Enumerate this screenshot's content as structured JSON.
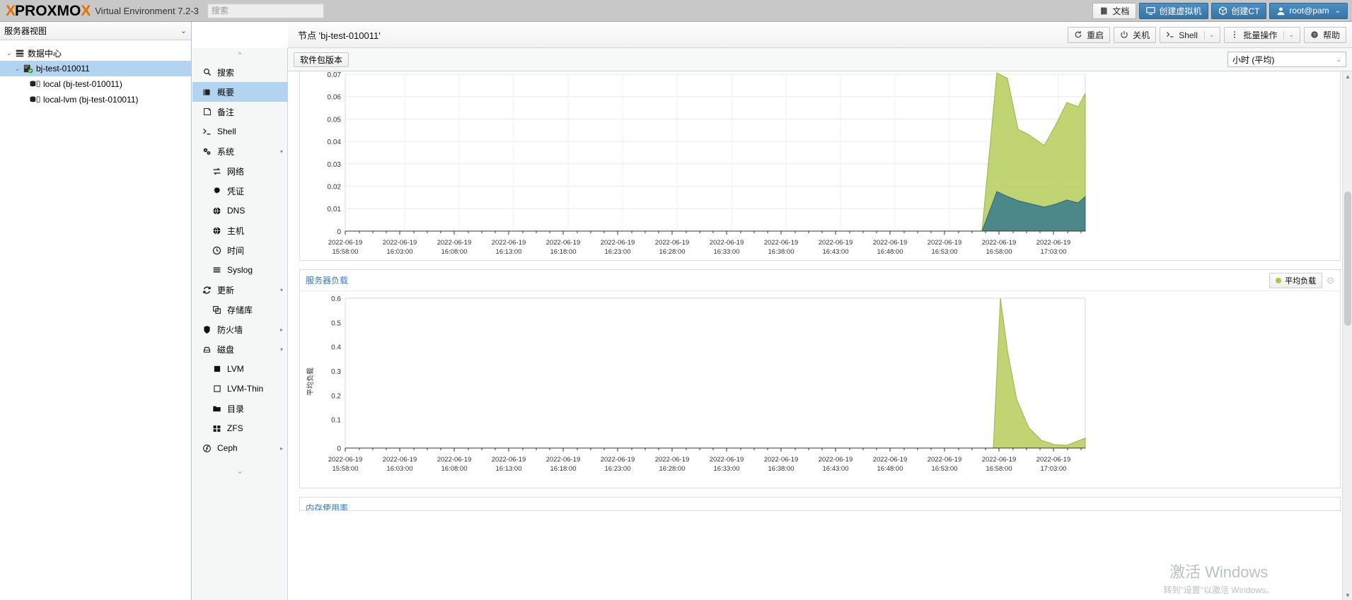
{
  "topbar": {
    "logo_x": "X",
    "logo_p": "PROXMO",
    "logo_x2": "X",
    "product": "Virtual Environment 7.2-3",
    "search_placeholder": "搜索",
    "search_value": "",
    "buttons": [
      {
        "label": "文档",
        "icon": "book-icon",
        "style": "plain"
      },
      {
        "label": "创建虚拟机",
        "icon": "monitor-icon",
        "style": "blue"
      },
      {
        "label": "创建CT",
        "icon": "container-icon",
        "style": "blue"
      },
      {
        "label": "root@pam",
        "icon": "user-icon",
        "style": "user",
        "chevron": "⌄"
      }
    ]
  },
  "sidebar": {
    "header": "服务器视图",
    "header_chevron": "⌄",
    "tree": [
      {
        "label": "数据中心",
        "icon": "datacenter-icon",
        "level": 0,
        "twisty": "⌄",
        "selected": false
      },
      {
        "label": "bj-test-010011",
        "icon": "node-icon",
        "level": 1,
        "twisty": "⌄",
        "selected": true
      },
      {
        "label": "local (bj-test-010011)",
        "icon": "storage-icon",
        "level": 2,
        "twisty": "",
        "selected": false
      },
      {
        "label": "local-lvm (bj-test-010011)",
        "icon": "storage-icon",
        "level": 2,
        "twisty": "",
        "selected": false
      }
    ]
  },
  "nodemenu": {
    "scroll_up": "⌃",
    "scroll_down": "⌄",
    "items": [
      {
        "label": "搜索",
        "icon": "search-icon",
        "sub": false,
        "selected": false,
        "arrow": ""
      },
      {
        "label": "概要",
        "icon": "summary-icon",
        "sub": false,
        "selected": true,
        "arrow": ""
      },
      {
        "label": "备注",
        "icon": "notes-icon",
        "sub": false,
        "selected": false,
        "arrow": ""
      },
      {
        "label": "Shell",
        "icon": "shell-icon",
        "sub": false,
        "selected": false,
        "arrow": ""
      },
      {
        "label": "系统",
        "icon": "system-icon",
        "sub": false,
        "selected": false,
        "arrow": "▾"
      },
      {
        "label": "网络",
        "icon": "network-icon",
        "sub": true,
        "selected": false,
        "arrow": ""
      },
      {
        "label": "凭证",
        "icon": "certificate-icon",
        "sub": true,
        "selected": false,
        "arrow": ""
      },
      {
        "label": "DNS",
        "icon": "dns-icon",
        "sub": true,
        "selected": false,
        "arrow": ""
      },
      {
        "label": "主机",
        "icon": "hosts-icon",
        "sub": true,
        "selected": false,
        "arrow": ""
      },
      {
        "label": "时间",
        "icon": "clock-icon",
        "sub": true,
        "selected": false,
        "arrow": ""
      },
      {
        "label": "Syslog",
        "icon": "syslog-icon",
        "sub": true,
        "selected": false,
        "arrow": ""
      },
      {
        "label": "更新",
        "icon": "update-icon",
        "sub": false,
        "selected": false,
        "arrow": "▾"
      },
      {
        "label": "存储库",
        "icon": "repository-icon",
        "sub": true,
        "selected": false,
        "arrow": ""
      },
      {
        "label": "防火墙",
        "icon": "firewall-icon",
        "sub": false,
        "selected": false,
        "arrow": "▸"
      },
      {
        "label": "磁盘",
        "icon": "disk-icon",
        "sub": false,
        "selected": false,
        "arrow": "▾"
      },
      {
        "label": "LVM",
        "icon": "lvm-icon",
        "sub": true,
        "selected": false,
        "arrow": ""
      },
      {
        "label": "LVM-Thin",
        "icon": "lvmthin-icon",
        "sub": true,
        "selected": false,
        "arrow": ""
      },
      {
        "label": "目录",
        "icon": "directory-icon",
        "sub": true,
        "selected": false,
        "arrow": ""
      },
      {
        "label": "ZFS",
        "icon": "zfs-icon",
        "sub": true,
        "selected": false,
        "arrow": ""
      },
      {
        "label": "Ceph",
        "icon": "ceph-icon",
        "sub": false,
        "selected": false,
        "arrow": "▸"
      }
    ]
  },
  "content": {
    "node_title": "节点 'bj-test-010011'",
    "header_buttons": [
      {
        "label": "重启",
        "icon": "restart-icon",
        "split": ""
      },
      {
        "label": "关机",
        "icon": "power-icon",
        "split": ""
      },
      {
        "label": "Shell",
        "icon": "shell-icon",
        "split": "⌄"
      },
      {
        "label": "批量操作",
        "icon": "bulk-icon",
        "split": "⌄"
      },
      {
        "label": "帮助",
        "icon": "help-icon",
        "split": ""
      }
    ],
    "tab_label": "软件包版本",
    "range_value": "小时 (平均)",
    "range_chevron": "⌄"
  },
  "chart_data": [
    {
      "type": "area",
      "title": "",
      "id": "chart-top",
      "ylabel": "",
      "xlabel": "",
      "yticks": [
        "0.07",
        "0.06",
        "0.05",
        "0.04",
        "0.03",
        "0.02",
        "0.01",
        "0"
      ],
      "ylim": [
        0,
        0.072
      ],
      "grid": true,
      "xticks": [
        "2022-06-19 15:58:00",
        "2022-06-19 16:03:00",
        "2022-06-19 16:08:00",
        "2022-06-19 16:13:00",
        "2022-06-19 16:18:00",
        "2022-06-19 16:23:00",
        "2022-06-19 16:28:00",
        "2022-06-19 16:33:00",
        "2022-06-19 16:38:00",
        "2022-06-19 16:43:00",
        "2022-06-19 16:48:00",
        "2022-06-19 16:53:00",
        "2022-06-19 16:58:00",
        "2022-06-19 17:03:00"
      ],
      "series": [
        {
          "name": "series-green",
          "color": "#b5cc5a",
          "x": [
            0,
            0.86,
            0.88,
            0.895,
            0.91,
            0.925,
            0.945,
            0.96,
            0.975,
            0.99,
            1.0
          ],
          "values": [
            0,
            0,
            0.0705,
            0.068,
            0.0465,
            0.044,
            0.0395,
            0.0485,
            0.0585,
            0.0565,
            0.0625
          ]
        },
        {
          "name": "series-teal",
          "color": "#3f7f8c",
          "x": [
            0,
            0.86,
            0.88,
            0.895,
            0.91,
            0.925,
            0.945,
            0.96,
            0.975,
            0.99,
            1.0
          ],
          "values": [
            0,
            0,
            0.0175,
            0.0155,
            0.0135,
            0.0125,
            0.0108,
            0.0118,
            0.0138,
            0.0125,
            0.0155
          ]
        }
      ]
    },
    {
      "type": "area",
      "title": "服务器负载",
      "id": "chart-load",
      "ylabel": "平均负载",
      "xlabel": "",
      "yticks": [
        "0.6",
        "0.5",
        "0.4",
        "0.3",
        "0.2",
        "0.1",
        "0"
      ],
      "ylim": [
        0,
        0.62
      ],
      "grid": false,
      "legend": [
        {
          "label": "平均负载",
          "color": "#a8c64a"
        }
      ],
      "legend_extra": "⊙",
      "xticks": [
        "2022-06-19 15:58:00",
        "2022-06-19 16:03:00",
        "2022-06-19 16:08:00",
        "2022-06-19 16:13:00",
        "2022-06-19 16:18:00",
        "2022-06-19 16:23:00",
        "2022-06-19 16:28:00",
        "2022-06-19 16:33:00",
        "2022-06-19 16:38:00",
        "2022-06-19 16:43:00",
        "2022-06-19 16:48:00",
        "2022-06-19 16:53:00",
        "2022-06-19 16:58:00",
        "2022-06-19 17:03:00"
      ],
      "series": [
        {
          "name": "平均负载",
          "color": "#a8c64a",
          "x": [
            0,
            0.875,
            0.885,
            0.9,
            0.92,
            0.94,
            0.96,
            0.975,
            0.99,
            1.0
          ],
          "values": [
            0,
            0,
            0.6,
            0.4,
            0.2,
            0.08,
            0.03,
            0.015,
            0.012,
            0.04
          ]
        }
      ]
    },
    {
      "type": "area",
      "title": "内存使用率",
      "id": "chart-mem",
      "partial": true
    }
  ],
  "watermark": {
    "line1": "激活 Windows",
    "line2": "转到\"设置\"以激活 Windows。"
  },
  "colors": {
    "accent_blue": "#3b7ab0",
    "selection": "#b3d4f0",
    "brand_orange": "#e57000",
    "chart_green": "#b5cc5a",
    "chart_teal": "#3f7f8c",
    "legend_green": "#a8c64a"
  }
}
